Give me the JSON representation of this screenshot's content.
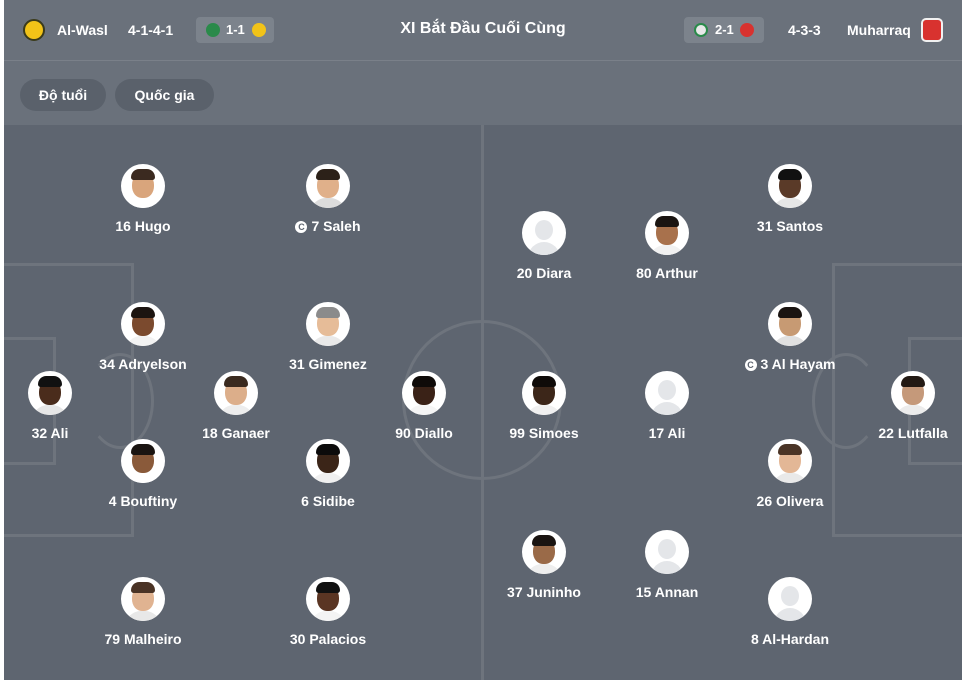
{
  "header": {
    "home": {
      "name": "Al-Wasl",
      "formation": "4-1-4-1",
      "last_score": "1-1"
    },
    "title": "XI Bắt Đầu Cuối Cùng",
    "away": {
      "name": "Muharraq",
      "formation": "4-3-3",
      "last_score": "2-1"
    }
  },
  "filters": {
    "age": "Độ tuổi",
    "nationality": "Quốc gia"
  },
  "colors": {
    "background": "#5e6570",
    "header": "#6a717b",
    "pitch_lines": "#6e747d",
    "text": "#ffffff"
  },
  "captain_icon": "C",
  "home_players": [
    {
      "label": "16 Hugo",
      "captain": false
    },
    {
      "label": "7 Saleh",
      "captain": true
    },
    {
      "label": "34 Adryelson",
      "captain": false
    },
    {
      "label": "31 Gimenez",
      "captain": false
    },
    {
      "label": "32 Ali",
      "captain": false
    },
    {
      "label": "18 Ganaer",
      "captain": false
    },
    {
      "label": "90 Diallo",
      "captain": false
    },
    {
      "label": "4 Bouftiny",
      "captain": false
    },
    {
      "label": "6 Sidibe",
      "captain": false
    },
    {
      "label": "79 Malheiro",
      "captain": false
    },
    {
      "label": "30 Palacios",
      "captain": false
    }
  ],
  "away_players": [
    {
      "label": "31 Santos",
      "captain": false
    },
    {
      "label": "20 Diara",
      "captain": false
    },
    {
      "label": "80 Arthur",
      "captain": false
    },
    {
      "label": "3 Al Hayam",
      "captain": true
    },
    {
      "label": "99 Simoes",
      "captain": false
    },
    {
      "label": "17 Ali",
      "captain": false
    },
    {
      "label": "22 Lutfalla",
      "captain": false
    },
    {
      "label": "26 Olivera",
      "captain": false
    },
    {
      "label": "37 Juninho",
      "captain": false
    },
    {
      "label": "15 Annan",
      "captain": false
    },
    {
      "label": "8 Al-Hardan",
      "captain": false
    }
  ]
}
